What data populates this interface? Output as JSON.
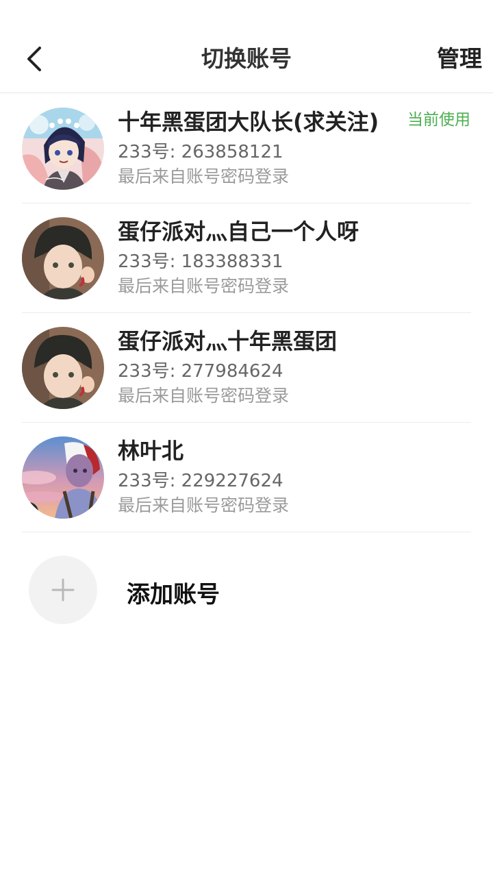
{
  "header": {
    "title": "切换账号",
    "back_icon": "chevron-left-icon",
    "manage_label": "管理"
  },
  "accounts": [
    {
      "name": "十年黑蛋团大队长(求关注)",
      "id_text": "233号: 263858121",
      "login_text": "最后来自账号密码登录",
      "badge": "当前使用",
      "avatar_icon": "anime-avatar-birthday"
    },
    {
      "name": "蛋仔派对灬自己一个人呀",
      "id_text": "233号: 183388331",
      "login_text": "最后来自账号密码登录",
      "avatar_icon": "anime-avatar-boy"
    },
    {
      "name": "蛋仔派对灬十年黑蛋团",
      "id_text": "233号: 277984624",
      "login_text": "最后来自账号密码登录",
      "avatar_icon": "anime-avatar-boy"
    },
    {
      "name": "林叶北",
      "id_text": "233号: 229227624",
      "login_text": "最后来自账号密码登录",
      "avatar_icon": "anime-avatar-sunset"
    }
  ],
  "add_account": {
    "label": "添加账号",
    "icon": "plus-icon"
  },
  "colors": {
    "badge_green": "#4caf50",
    "divider": "#ebebeb",
    "secondary_text": "#666666",
    "tertiary_text": "#9a9a9a"
  }
}
